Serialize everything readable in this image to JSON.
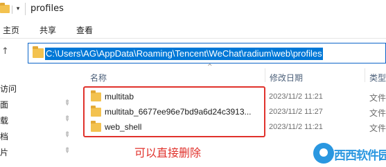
{
  "window": {
    "title": "profiles"
  },
  "quick_access": {
    "menu_glyph": "▾"
  },
  "ribbon": {
    "tabs": [
      "主页",
      "共享",
      "查看"
    ]
  },
  "address_bar": {
    "path": "C:\\Users\\AG\\AppData\\Roaming\\Tencent\\WeChat\\radium\\web\\profiles"
  },
  "nav_pane": {
    "items": [
      {
        "label": "访问",
        "pinned": false
      },
      {
        "label": "面",
        "pinned": true
      },
      {
        "label": "载",
        "pinned": true
      },
      {
        "label": "档",
        "pinned": true
      },
      {
        "label": "片",
        "pinned": true
      }
    ]
  },
  "file_list": {
    "columns": {
      "name": "名称",
      "modified": "修改日期",
      "type": "类型"
    },
    "rows": [
      {
        "name": "multitab",
        "modified": "2023/11/2 11:21",
        "type": "文件"
      },
      {
        "name": "multitab_6677ee96e7bd9a6d24c3913...",
        "modified": "2023/11/2 11:27",
        "type": "文件"
      },
      {
        "name": "web_shell",
        "modified": "2023/11/2 11:21",
        "type": "文件"
      }
    ]
  },
  "annotation": {
    "text": "可以直接删除",
    "color": "#e0312b"
  },
  "watermark": {
    "text": "西西软件园"
  },
  "colors": {
    "selection": "#0078d7",
    "folder": "#f3c24f",
    "highlight": "#e0312b"
  }
}
